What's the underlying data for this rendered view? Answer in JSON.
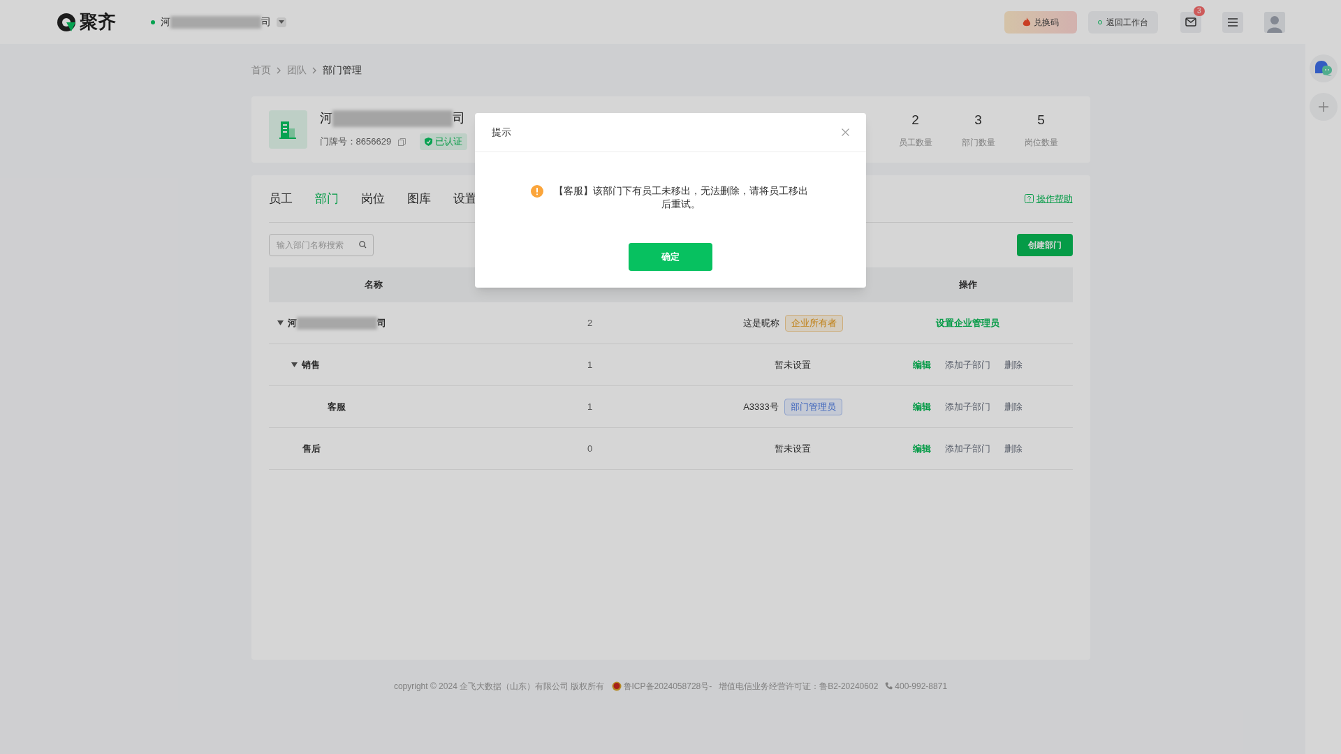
{
  "header": {
    "logo_text": "聚齐",
    "company": {
      "start": "河",
      "end": "司"
    },
    "exchange_button": "兑换码",
    "workbench_button": "返回工作台",
    "mail_badge": "3"
  },
  "breadcrumb": [
    {
      "label": "首页",
      "current": false
    },
    {
      "label": "团队",
      "current": false
    },
    {
      "label": "部门管理",
      "current": true
    }
  ],
  "company_card": {
    "name_start": "河",
    "name_end": "司",
    "door_number": "门牌号：8656629",
    "verified": "已认证",
    "stats": [
      {
        "value": "2",
        "label": "员工数量"
      },
      {
        "value": "3",
        "label": "部门数量"
      },
      {
        "value": "5",
        "label": "岗位数量"
      }
    ]
  },
  "tabs": [
    {
      "label": "员工",
      "selected": false
    },
    {
      "label": "部门",
      "selected": true
    },
    {
      "label": "岗位",
      "selected": false
    },
    {
      "label": "图库",
      "selected": false
    },
    {
      "label": "设置",
      "selected": false
    }
  ],
  "help_link": "操作帮助",
  "search": {
    "placeholder": "输入部门名称搜索"
  },
  "create_button": "创建部门",
  "table": {
    "columns": [
      "名称",
      "操作"
    ],
    "rows": [
      {
        "name_start": "河",
        "name_end": "司",
        "count": "2",
        "manager": "这是昵称",
        "role": {
          "text": "企业所有者",
          "kind": "owner"
        },
        "expanded": true,
        "actions": [
          {
            "label": "设置企业管理员",
            "kind": "primary"
          }
        ],
        "children": [
          {
            "name": "销售",
            "count": "1",
            "manager": "暂未设置",
            "expanded": true,
            "actions": [
              {
                "label": "编辑",
                "kind": "primary"
              },
              {
                "label": "添加子部门",
                "kind": "normal"
              },
              {
                "label": "删除",
                "kind": "normal"
              }
            ],
            "children": [
              {
                "name": "客服",
                "count": "1",
                "manager": "A3333号",
                "role": {
                  "text": "部门管理员",
                  "kind": "admin"
                },
                "actions": [
                  {
                    "label": "编辑",
                    "kind": "primary"
                  },
                  {
                    "label": "添加子部门",
                    "kind": "normal"
                  },
                  {
                    "label": "删除",
                    "kind": "normal"
                  }
                ]
              }
            ]
          },
          {
            "name": "售后",
            "count": "0",
            "manager": "暂未设置",
            "actions": [
              {
                "label": "编辑",
                "kind": "primary"
              },
              {
                "label": "添加子部门",
                "kind": "normal"
              },
              {
                "label": "删除",
                "kind": "normal"
              }
            ]
          }
        ]
      }
    ]
  },
  "footer": {
    "copyright": "copyright © 2024 企飞大数据（山东）有限公司 版权所有",
    "icp": "鲁ICP备2024058728号-",
    "license": "增值电信业务经营许可证：鲁B2-20240602",
    "phone": "400-992-8871"
  },
  "dialog": {
    "title": "提示",
    "message": "【客服】该部门下有员工未移出，无法删除，请将员工移出后重试。",
    "confirm": "确定"
  }
}
